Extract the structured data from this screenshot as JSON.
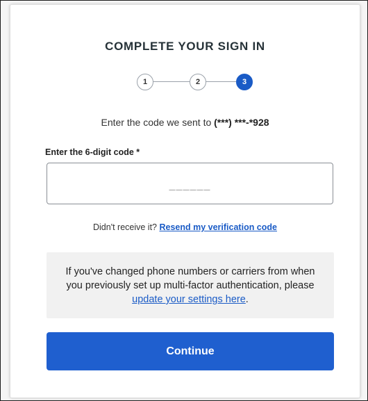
{
  "title": "COMPLETE YOUR SIGN IN",
  "steps": [
    "1",
    "2",
    "3"
  ],
  "active_step": 3,
  "sent_message": {
    "prefix": "Enter the code we sent to ",
    "phone": "(***) ***-*928"
  },
  "code_field": {
    "label": "Enter the 6-digit code *",
    "value": "",
    "placeholder": "______"
  },
  "resend": {
    "prefix": "Didn't receive it? ",
    "link": "Resend my verification code"
  },
  "info": {
    "text": "If you've changed phone numbers or carriers from when you previously set up multi-factor authentication, please ",
    "link": "update your settings here",
    "suffix": "."
  },
  "continue_label": "Continue",
  "colors": {
    "primary": "#1f5fcf",
    "link": "#1a5bc6",
    "info_bg": "#f1f1f1"
  }
}
